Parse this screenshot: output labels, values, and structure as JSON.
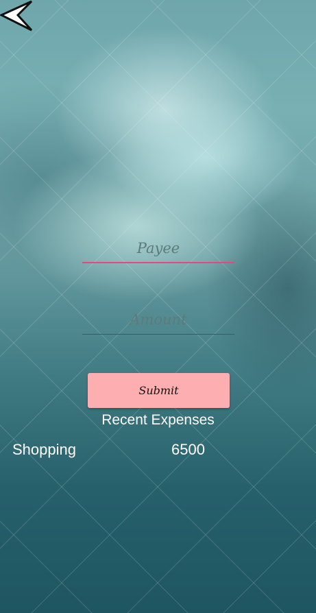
{
  "nav": {
    "back_icon": "back-arrow-icon"
  },
  "form": {
    "payee_placeholder": "Payee",
    "payee_value": "",
    "amount_placeholder": "Amount",
    "amount_value": "",
    "submit_label": "Submit"
  },
  "recent": {
    "title": "Recent Expenses",
    "items": [
      {
        "name": "Shopping",
        "amount": "6500"
      }
    ]
  },
  "colors": {
    "accent_underline": "#e8477e",
    "submit_bg": "#fdaeb1"
  }
}
